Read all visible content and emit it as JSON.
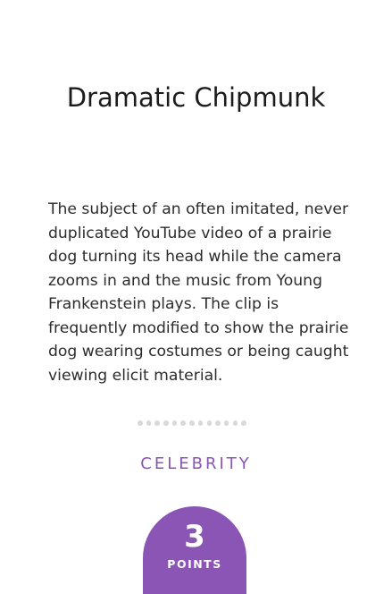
{
  "card": {
    "title": "Dramatic Chipmunk",
    "description": "The subject of an often imitated, never duplicated YouTube video of a prairie dog turning its head while the camera zooms in and the music from Young Frankenstein plays. The clip is frequently modified to show the prairie dog wearing costumes or being caught viewing elicit material.",
    "category": "CELEBRITY",
    "points": {
      "value": "3",
      "label": "POINTS"
    }
  },
  "colors": {
    "accent": "#8a55b4",
    "dot": "#d9d9d9",
    "text": "#1b1b1b"
  }
}
